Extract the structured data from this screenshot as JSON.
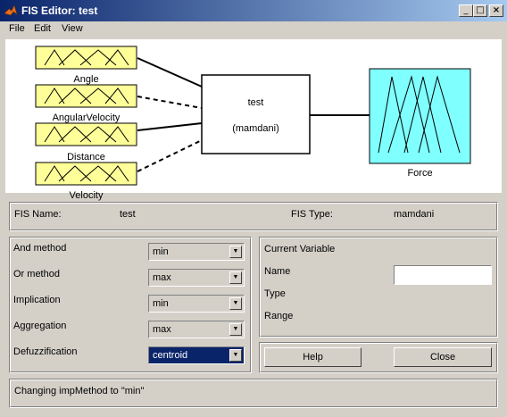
{
  "window": {
    "title": "FIS Editor: test"
  },
  "menu": [
    "File",
    "Edit",
    "View"
  ],
  "inputs": [
    "Angle",
    "AngularVelocity",
    "Distance",
    "Velocity"
  ],
  "system": {
    "name": "test",
    "type": "(mamdani)"
  },
  "output": {
    "name": "Force"
  },
  "fis": {
    "name_label": "FIS Name:",
    "name_value": "test",
    "type_label": "FIS Type:",
    "type_value": "mamdani"
  },
  "methods": [
    {
      "label": "And method",
      "value": "min"
    },
    {
      "label": "Or method",
      "value": "max"
    },
    {
      "label": "Implication",
      "value": "min"
    },
    {
      "label": "Aggregation",
      "value": "max"
    },
    {
      "label": "Defuzzification",
      "value": "centroid"
    }
  ],
  "current_variable": {
    "title": "Current Variable",
    "name_label": "Name",
    "type_label": "Type",
    "range_label": "Range",
    "name_value": ""
  },
  "buttons": {
    "help": "Help",
    "close": "Close"
  },
  "status": "Changing impMethod to \"min\"",
  "colors": {
    "input_fill": "#ffff99",
    "output_fill": "#80ffff",
    "titlebar": "#0a246a",
    "selected": "#0a246a"
  }
}
